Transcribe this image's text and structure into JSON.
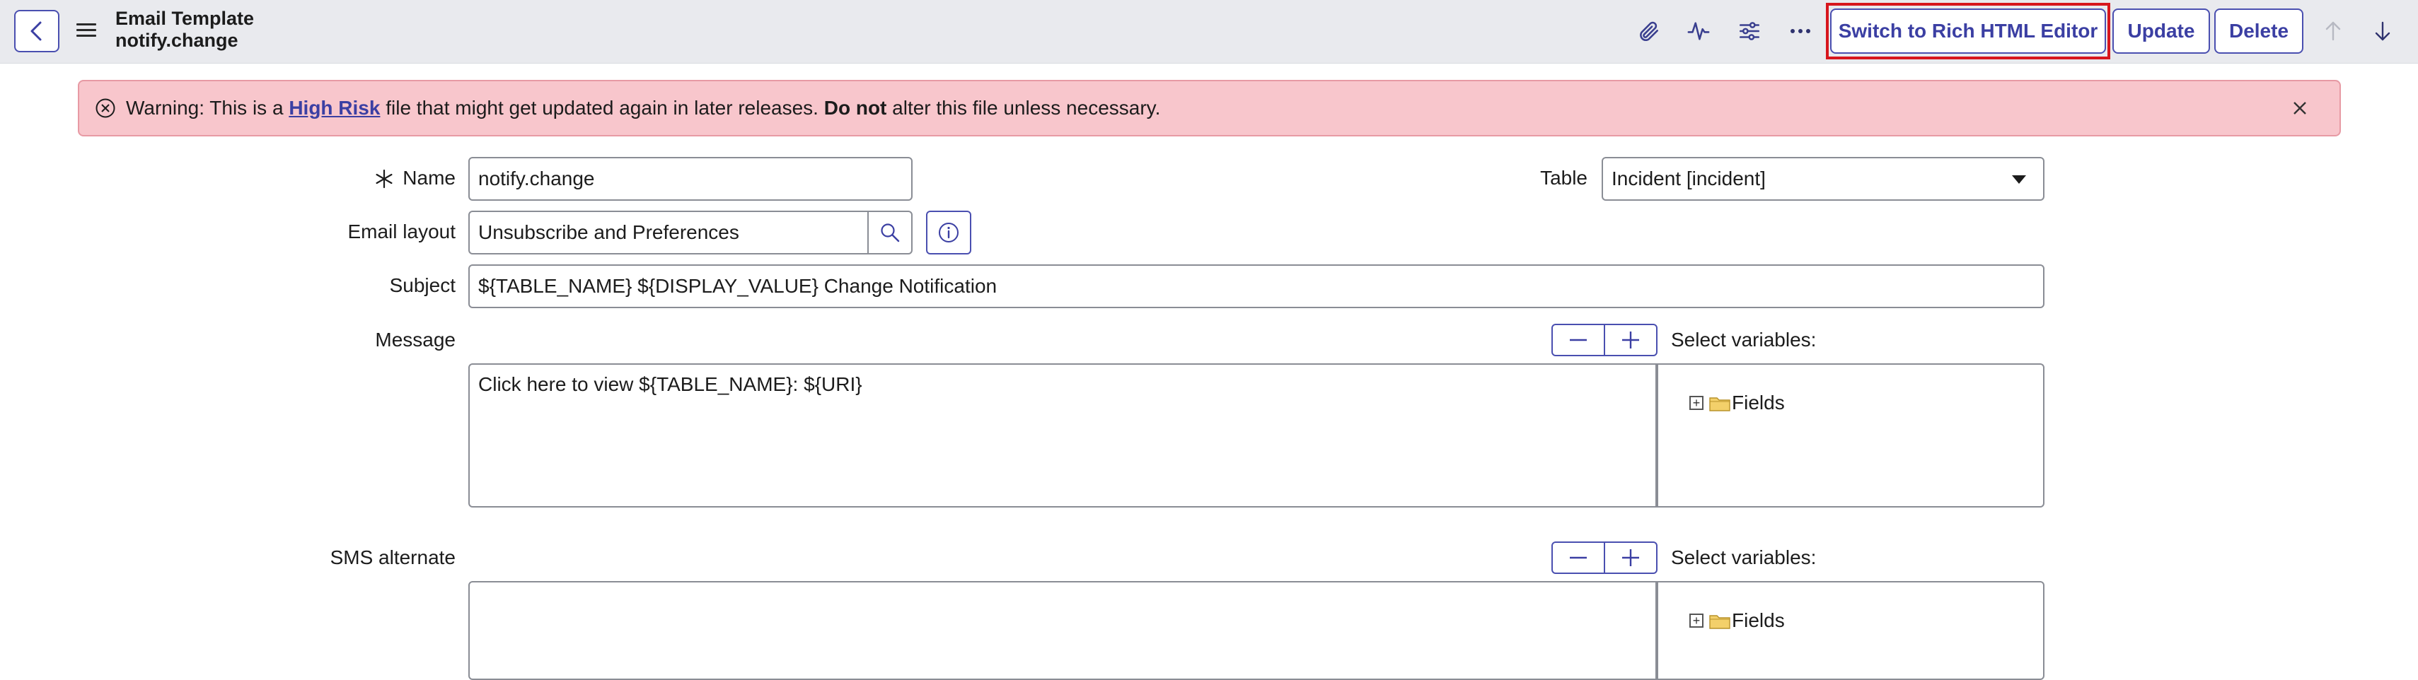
{
  "header": {
    "title_line1": "Email Template",
    "title_line2": "notify.change",
    "buttons": {
      "rich_editor": "Switch to Rich HTML Editor",
      "update": "Update",
      "delete": "Delete"
    }
  },
  "banner": {
    "prefix": "Warning: This is a ",
    "link": "High Risk",
    "middle": " file that might get updated again in later releases. ",
    "bold": "Do not",
    "suffix": " alter this file unless necessary."
  },
  "form": {
    "name": {
      "label": "Name",
      "value": "notify.change"
    },
    "table": {
      "label": "Table",
      "value": "Incident [incident]"
    },
    "email_layout": {
      "label": "Email layout",
      "value": "Unsubscribe and Preferences"
    },
    "subject": {
      "label": "Subject",
      "value": "${TABLE_NAME} ${DISPLAY_VALUE} Change Notification"
    },
    "message": {
      "label": "Message",
      "value": "Click here to view ${TABLE_NAME}: ${URI}",
      "select_variables_label": "Select variables:",
      "tree_root": "Fields"
    },
    "sms": {
      "label": "SMS alternate",
      "value": "",
      "select_variables_label": "Select variables:",
      "tree_root": "Fields"
    }
  },
  "colors": {
    "accent": "#3b3fa3",
    "warning_bg": "#f8c6cc",
    "highlight": "#d7161d"
  },
  "icons": [
    "back-chevron-icon",
    "hamburger-icon",
    "paperclip-icon",
    "activity-icon",
    "sliders-icon",
    "more-icon",
    "arrow-up-icon",
    "arrow-down-icon",
    "x-circle-icon",
    "close-icon",
    "search-icon",
    "info-icon",
    "dropdown-caret-icon",
    "minus-icon",
    "plus-icon",
    "tree-expand-icon",
    "folder-icon",
    "required-asterisk-icon"
  ]
}
